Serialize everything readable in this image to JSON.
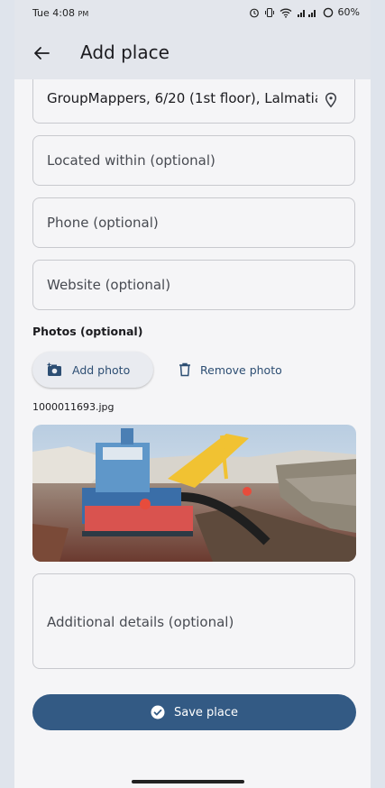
{
  "status_bar": {
    "time": "Tue 4:08",
    "ampm": "PM",
    "battery": "60%"
  },
  "app_bar": {
    "title": "Add place"
  },
  "form": {
    "address_value": "GroupMappers, 6/20 (1st floor), Lalmatia",
    "located_within_placeholder": "Located within (optional)",
    "phone_placeholder": "Phone (optional)",
    "website_placeholder": "Website (optional)",
    "photos_label": "Photos (optional)",
    "add_photo_label": "Add photo",
    "remove_photo_label": "Remove photo",
    "photo_filename": "1000011693.jpg",
    "details_placeholder": "Additional details (optional)",
    "save_label": "Save place"
  },
  "colors": {
    "accent": "#335a84",
    "link": "#2d4e73",
    "appbar": "#e3e6ec"
  },
  "icons": [
    "back-arrow-icon",
    "location-pin-icon",
    "add-photo-icon",
    "trash-icon",
    "check-circle-icon"
  ]
}
